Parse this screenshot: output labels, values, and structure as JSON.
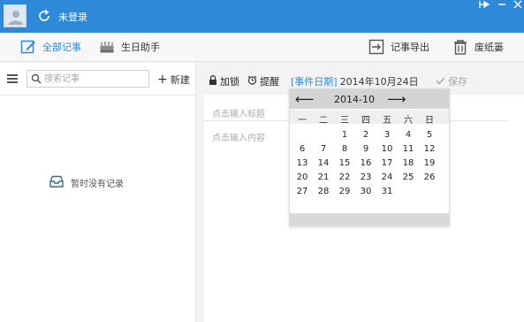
{
  "titlebar": {
    "login_status": "未登录",
    "bg_color": "#2e8ad8"
  },
  "toolbar": {
    "all_notes": "全部记事",
    "birthday_helper": "生日助手",
    "export_notes": "记事导出",
    "trash": "废纸篓"
  },
  "left": {
    "search_placeholder": "搜索记事",
    "new_button": "新建",
    "empty_text": "暂时没有记录"
  },
  "editor": {
    "encrypt": "加锁",
    "reminder": "提醒",
    "event_date_label": "[事件日期]",
    "event_date_value": "2014年10月24日",
    "save": "保存",
    "title_placeholder": "点击输入标题",
    "content_placeholder": "点击输入内容"
  },
  "calendar": {
    "month_label": "2014-10",
    "prev": "⟵",
    "next": "⟶",
    "weekdays": [
      "一",
      "二",
      "三",
      "四",
      "五",
      "六",
      "日"
    ],
    "first_weekday_index": 2,
    "days_in_month": 31
  },
  "icons": {
    "avatar": "user-avatar-icon",
    "sync": "sync-icon",
    "all_notes": "edit-note-icon",
    "birthday": "cake-icon",
    "export": "export-icon",
    "trash": "trash-icon",
    "menu": "menu-icon",
    "search": "search-icon",
    "empty": "inbox-icon",
    "lock": "lock-icon",
    "alarm": "alarm-clock-icon",
    "check": "check-icon"
  }
}
